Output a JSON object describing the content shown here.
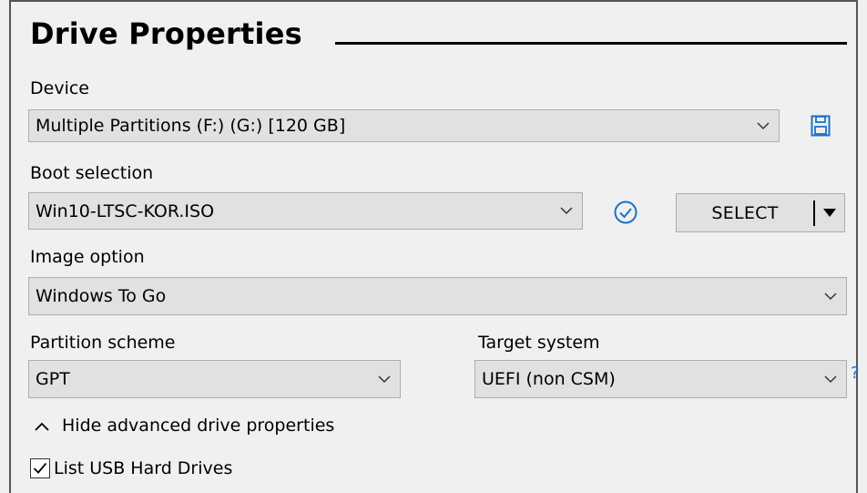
{
  "section": {
    "title": "Drive Properties"
  },
  "device": {
    "label": "Device",
    "value": "Multiple Partitions (F:) (G:) [120 GB]"
  },
  "boot": {
    "label": "Boot selection",
    "value": "Win10-LTSC-KOR.ISO",
    "select_label": "SELECT"
  },
  "image_option": {
    "label": "Image option",
    "value": "Windows To Go"
  },
  "partition": {
    "label": "Partition scheme",
    "value": "GPT"
  },
  "target": {
    "label": "Target system",
    "value": "UEFI (non CSM)",
    "help": "?"
  },
  "advanced": {
    "toggle_label": "Hide advanced drive properties"
  },
  "list_usb": {
    "label": "List USB Hard Drives",
    "checked": true
  },
  "icons": {
    "save": "save-icon",
    "verify": "check-circle-icon",
    "dropdown": "chevron-down-icon",
    "collapse": "chevron-up-icon"
  },
  "colors": {
    "accent": "#1a73c8",
    "control_bg": "#e1e1e1",
    "window_bg": "#f0f0f0"
  }
}
